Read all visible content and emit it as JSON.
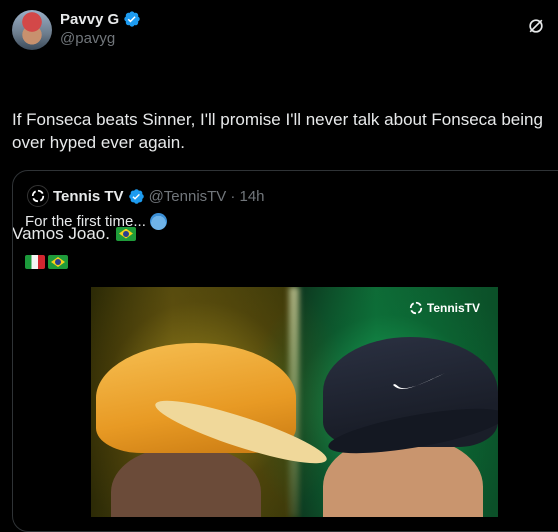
{
  "post": {
    "display_name": "Pavvy G",
    "handle": "@pavyg",
    "text_line1": "If Fonseca beats Sinner, I'll promise I'll never talk about Fonseca being over hyped ever again.",
    "text_line2": "Vamos Joao."
  },
  "quoted_post": {
    "display_name": "Tennis TV",
    "handle": "@TennisTV",
    "time": "· 14h",
    "text": "For the first time...",
    "media": {
      "logo_text": "TennisTV"
    }
  },
  "colors": {
    "background": "#000000",
    "text": "#e7e9ea",
    "muted": "#71767b",
    "verified": "#1d9bf0",
    "border": "#2f3336"
  },
  "icons": {
    "verified": "verified-badge-icon",
    "grok": "grok-icon",
    "flag_brazil": "brazil-flag-icon",
    "flag_italy": "italy-flag-icon"
  }
}
